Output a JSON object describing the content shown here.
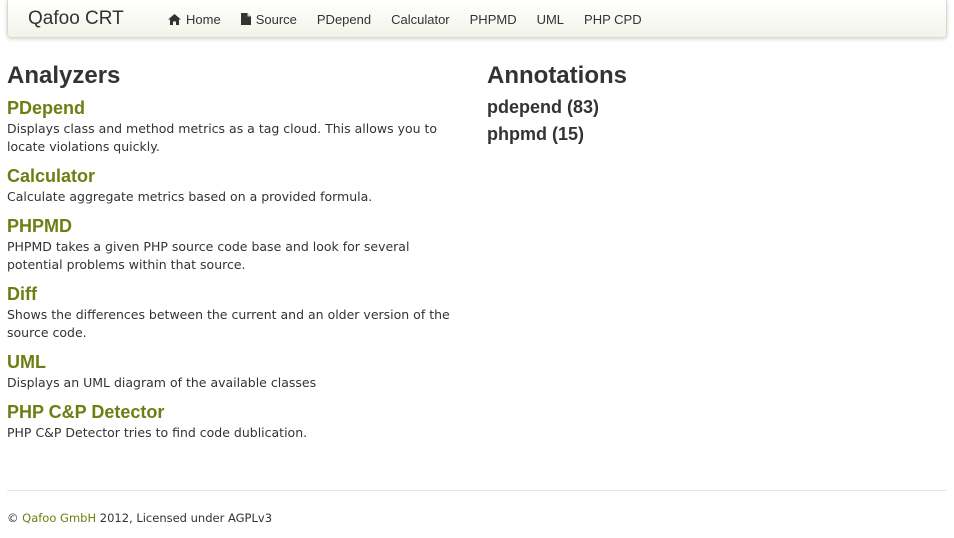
{
  "navbar": {
    "brand": "Qafoo CRT",
    "items": [
      {
        "label": "Home",
        "icon": "home-icon"
      },
      {
        "label": "Source",
        "icon": "file-icon"
      },
      {
        "label": "PDepend"
      },
      {
        "label": "Calculator"
      },
      {
        "label": "PHPMD"
      },
      {
        "label": "UML"
      },
      {
        "label": "PHP CPD"
      }
    ]
  },
  "analyzers": {
    "heading": "Analyzers",
    "items": [
      {
        "title": "PDepend",
        "description": "Displays class and method metrics as a tag cloud. This allows you to locate violations quickly."
      },
      {
        "title": "Calculator",
        "description": "Calculate aggregate metrics based on a provided formula."
      },
      {
        "title": "PHPMD",
        "description": "PHPMD takes a given PHP source code base and look for several potential problems within that source."
      },
      {
        "title": "Diff",
        "description": "Shows the differences between the current and an older version of the source code."
      },
      {
        "title": "UML",
        "description": "Displays an UML diagram of the available classes"
      },
      {
        "title": "PHP C&P Detector",
        "description": "PHP C&P Detector tries to find code dublication."
      }
    ]
  },
  "annotations": {
    "heading": "Annotations",
    "items": [
      "pdepend (83)",
      "phpmd (15)"
    ]
  },
  "footer": {
    "copyright": "©",
    "company": "Qafoo GmbH",
    "text": "2012, Licensed under AGPLv3"
  },
  "colors": {
    "accent": "#6b7f12",
    "text": "#333333"
  }
}
